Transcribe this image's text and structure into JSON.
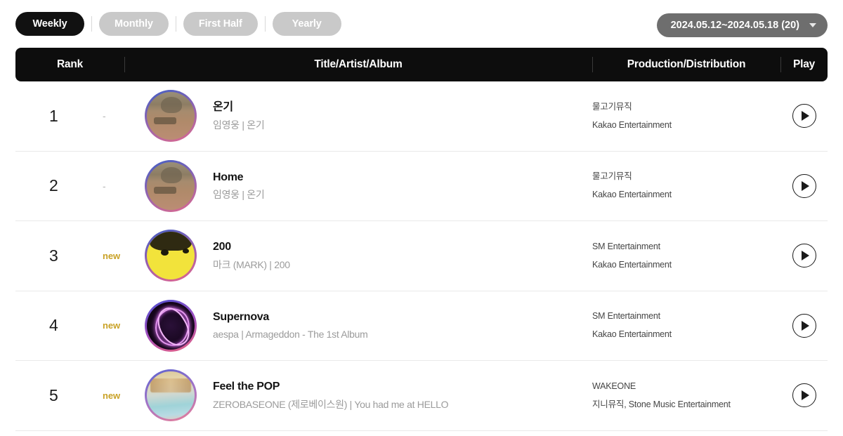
{
  "period_tabs": [
    {
      "label": "Weekly",
      "active": true
    },
    {
      "label": "Monthly",
      "active": false
    },
    {
      "label": "First Half",
      "active": false
    },
    {
      "label": "Yearly",
      "active": false
    }
  ],
  "date_select": {
    "value": "2024.05.12~2024.05.18 (20)",
    "caret_icon": "chevron-down-icon"
  },
  "columns": {
    "rank": "Rank",
    "title": "Title/Artist/Album",
    "production": "Production/Distribution",
    "play": "Play"
  },
  "colors": {
    "header_bg": "#0d0d0d",
    "active_pill": "#111111",
    "inactive_pill": "#c9c9c9",
    "date_pill": "#6e6e6e",
    "new_badge": "#c9a227",
    "row_border": "#e9e9e9",
    "subtitle": "#9b9b9b"
  },
  "rows": [
    {
      "rank": "1",
      "change": "-",
      "change_type": "same",
      "title": "온기",
      "subtitle": "임영웅 | 온기",
      "production": "물고기뮤직",
      "distribution": "Kakao Entertainment",
      "art_class": "art-onki",
      "play_icon": "play-icon"
    },
    {
      "rank": "2",
      "change": "-",
      "change_type": "same",
      "title": "Home",
      "subtitle": "임영웅 | 온기",
      "production": "물고기뮤직",
      "distribution": "Kakao Entertainment",
      "art_class": "art-onki",
      "play_icon": "play-icon"
    },
    {
      "rank": "3",
      "change": "new",
      "change_type": "new",
      "title": "200",
      "subtitle": "마크 (MARK) | 200",
      "production": "SM Entertainment",
      "distribution": "Kakao Entertainment",
      "art_class": "art-200",
      "play_icon": "play-icon"
    },
    {
      "rank": "4",
      "change": "new",
      "change_type": "new",
      "title": "Supernova",
      "subtitle": "aespa | Armageddon - The 1st Album",
      "production": "SM Entertainment",
      "distribution": "Kakao Entertainment",
      "art_class": "art-super",
      "play_icon": "play-icon"
    },
    {
      "rank": "5",
      "change": "new",
      "change_type": "new",
      "title": "Feel the POP",
      "subtitle": "ZEROBASEONE (제로베이스원) | You had me at HELLO",
      "production": "WAKEONE",
      "distribution": "지니뮤직, Stone Music Entertainment",
      "art_class": "art-feel",
      "play_icon": "play-icon"
    }
  ]
}
